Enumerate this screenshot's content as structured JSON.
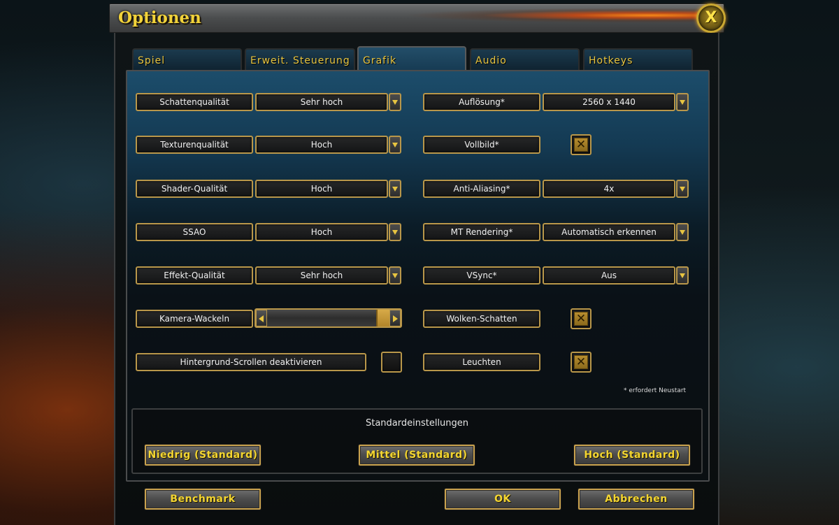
{
  "window": {
    "title": "Optionen",
    "close_glyph": "X"
  },
  "tabs": [
    {
      "label": "Spiel",
      "active": false
    },
    {
      "label": "Erweit. Steuerung",
      "active": false
    },
    {
      "label": "Grafik",
      "active": true
    },
    {
      "label": "Audio",
      "active": false
    },
    {
      "label": "Hotkeys",
      "active": false
    }
  ],
  "settings_left": {
    "shadow_quality": {
      "label": "Schattenqualität",
      "value": "Sehr hoch"
    },
    "texture_quality": {
      "label": "Texturenqualität",
      "value": "Hoch"
    },
    "shader_quality": {
      "label": "Shader-Qualität",
      "value": "Hoch"
    },
    "ssao": {
      "label": "SSAO",
      "value": "Hoch"
    },
    "effect_quality": {
      "label": "Effekt-Qualität",
      "value": "Sehr hoch"
    },
    "camera_shake": {
      "label": "Kamera-Wackeln",
      "level": 1.0
    },
    "background_scroll": {
      "label": "Hintergrund-Scrollen deaktivieren",
      "checked": false
    }
  },
  "settings_right": {
    "resolution": {
      "label": "Auflösung*",
      "value": "2560 x 1440"
    },
    "fullscreen": {
      "label": "Vollbild*",
      "checked": true
    },
    "anti_aliasing": {
      "label": "Anti-Aliasing*",
      "value": "4x"
    },
    "mt_rendering": {
      "label": "MT Rendering*",
      "value": "Automatisch erkennen"
    },
    "vsync": {
      "label": "VSync*",
      "value": "Aus"
    },
    "cloud_shadows": {
      "label": "Wolken-Schatten",
      "checked": true
    },
    "glow": {
      "label": "Leuchten",
      "checked": true
    }
  },
  "restart_note": "* erfordert Neustart",
  "defaults": {
    "title": "Standardeinstellungen",
    "low": "Niedrig (Standard)",
    "medium": "Mittel (Standard)",
    "high": "Hoch (Standard)"
  },
  "footer": {
    "benchmark": "Benchmark",
    "ok": "OK",
    "cancel": "Abbrechen"
  },
  "check_glyph": "✕",
  "colors": {
    "gold_text": "#f4d631",
    "tab_text": "#e8c642",
    "border_gold": "#b9974a",
    "panel_blue": "#1c4d6b"
  },
  "icons": {
    "dropdown": "chevron-down-icon",
    "slider_left": "arrow-left-icon",
    "slider_right": "arrow-right-icon",
    "checkbox": "checkbox-icon",
    "close": "close-icon"
  }
}
